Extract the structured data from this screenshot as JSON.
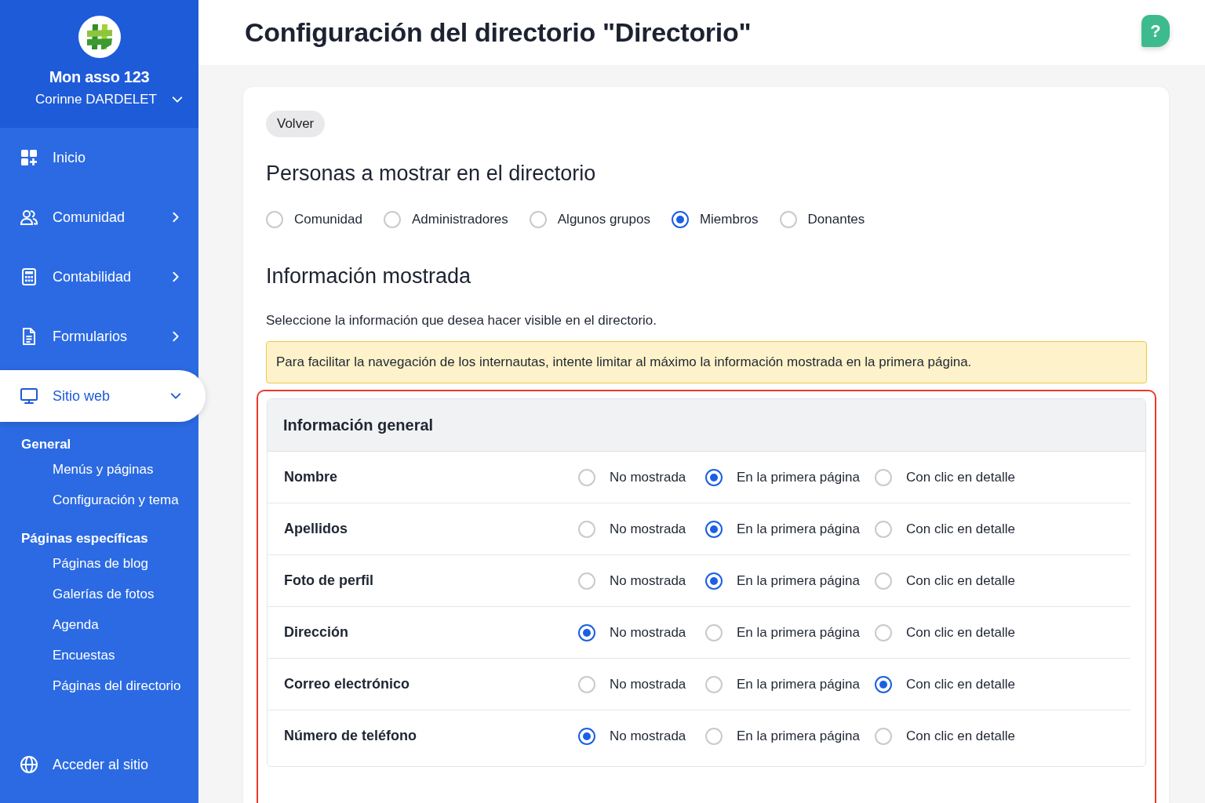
{
  "sidebar": {
    "org_name": "Mon asso 123",
    "user_name": "Corinne DARDELET",
    "nav": [
      {
        "label": "Inicio",
        "selected": false
      },
      {
        "label": "Comunidad",
        "expanded": false,
        "selected": false
      },
      {
        "label": "Contabilidad",
        "expanded": false,
        "selected": false
      },
      {
        "label": "Formularios",
        "expanded": false,
        "selected": false
      },
      {
        "label": "Sitio web",
        "expanded": true,
        "selected": true,
        "groups": [
          {
            "heading": "General",
            "items": [
              "Menús y páginas",
              "Configuración y tema"
            ]
          },
          {
            "heading": "Páginas específicas",
            "items": [
              "Páginas de blog",
              "Galerías de fotos",
              "Agenda",
              "Encuestas",
              "Páginas del directorio"
            ]
          }
        ]
      }
    ],
    "footer_link": "Acceder al sitio"
  },
  "header": {
    "title": "Configuración del directorio \"Directorio\"",
    "help_button": "?"
  },
  "card": {
    "back_button": "Volver",
    "people_section": {
      "heading": "Personas a mostrar en el directorio",
      "options": [
        {
          "label": "Comunidad",
          "selected": false
        },
        {
          "label": "Administradores",
          "selected": false
        },
        {
          "label": "Algunos grupos",
          "selected": false
        },
        {
          "label": "Miembros",
          "selected": true
        },
        {
          "label": "Donantes",
          "selected": false
        }
      ]
    },
    "info_section": {
      "heading": "Información mostrada",
      "description": "Seleccione la información que desea hacer visible en el directorio.",
      "warning": "Para facilitar la navegación de los internautas, intente limitar al máximo la información mostrada en la primera página.",
      "group": {
        "title": "Información general",
        "highlighted": true,
        "rows": [
          {
            "label": "Nombre",
            "options": [
              {
                "label": "No mostrada",
                "selected": false
              },
              {
                "label": "En la primera página",
                "selected": true
              },
              {
                "label": "Con clic en detalle",
                "selected": false
              }
            ]
          },
          {
            "label": "Apellidos",
            "options": [
              {
                "label": "No mostrada",
                "selected": false
              },
              {
                "label": "En la primera página",
                "selected": true
              },
              {
                "label": "Con clic en detalle",
                "selected": false
              }
            ]
          },
          {
            "label": "Foto de perfil",
            "options": [
              {
                "label": "No mostrada",
                "selected": false
              },
              {
                "label": "En la primera página",
                "selected": true
              },
              {
                "label": "Con clic en detalle",
                "selected": false
              }
            ]
          },
          {
            "label": "Dirección",
            "options": [
              {
                "label": "No mostrada",
                "selected": true
              },
              {
                "label": "En la primera página",
                "selected": false
              },
              {
                "label": "Con clic en detalle",
                "selected": false
              }
            ]
          },
          {
            "label": "Correo electrónico",
            "options": [
              {
                "label": "No mostrada",
                "selected": false
              },
              {
                "label": "En la primera página",
                "selected": false
              },
              {
                "label": "Con clic en detalle",
                "selected": true
              }
            ]
          },
          {
            "label": "Número de teléfono",
            "options": [
              {
                "label": "No mostrada",
                "selected": true
              },
              {
                "label": "En la primera página",
                "selected": false
              },
              {
                "label": "Con clic en detalle",
                "selected": false
              }
            ]
          }
        ]
      }
    }
  }
}
